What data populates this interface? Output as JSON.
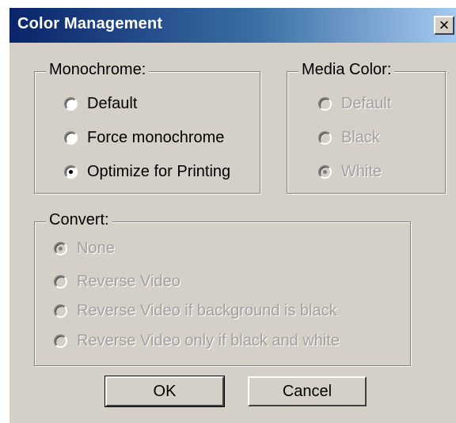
{
  "window": {
    "title": "Color Management",
    "close_glyph": "×"
  },
  "monochrome": {
    "label": "Monochrome:",
    "options": [
      {
        "label": "Default",
        "checked": false,
        "enabled": true
      },
      {
        "label": "Force monochrome",
        "checked": false,
        "enabled": true
      },
      {
        "label": "Optimize for Printing",
        "checked": true,
        "enabled": true
      }
    ]
  },
  "media_color": {
    "label": "Media Color:",
    "options": [
      {
        "label": "Default",
        "checked": false,
        "enabled": false
      },
      {
        "label": "Black",
        "checked": false,
        "enabled": false
      },
      {
        "label": "White",
        "checked": true,
        "enabled": false
      }
    ]
  },
  "convert": {
    "label": "Convert:",
    "options": [
      {
        "label": "None",
        "checked": true,
        "enabled": false
      },
      {
        "label": "Reverse Video",
        "checked": false,
        "enabled": false
      },
      {
        "label": "Reverse Video if background is black",
        "checked": false,
        "enabled": false
      },
      {
        "label": "Reverse Video only if black and white",
        "checked": false,
        "enabled": false
      }
    ]
  },
  "buttons": {
    "ok": "OK",
    "cancel": "Cancel"
  }
}
